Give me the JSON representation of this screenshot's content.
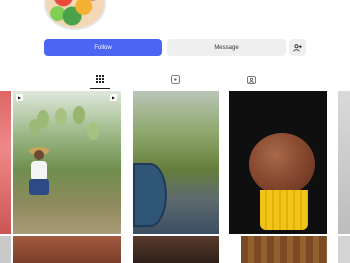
{
  "profile": {
    "avatar_icon": "fruit-bowl-avatar-image"
  },
  "actions": {
    "follow_label": "Follow",
    "message_label": "Message",
    "add_user_icon": "add-user-icon",
    "colors": {
      "follow_bg": "#4a66f3",
      "secondary_bg": "#efefef"
    }
  },
  "tabs": [
    {
      "icon": "grid-icon",
      "active": true
    },
    {
      "icon": "reels-icon",
      "active": false
    },
    {
      "icon": "tagged-icon",
      "active": false
    }
  ],
  "grid": {
    "posts": [
      {
        "subject": "mango-farm-photo",
        "badge": "reel-icon"
      },
      {
        "subject": "outdoor-cooking-photo",
        "badge": ""
      },
      {
        "subject": "coconut-dessert-photo",
        "badge": ""
      }
    ]
  }
}
